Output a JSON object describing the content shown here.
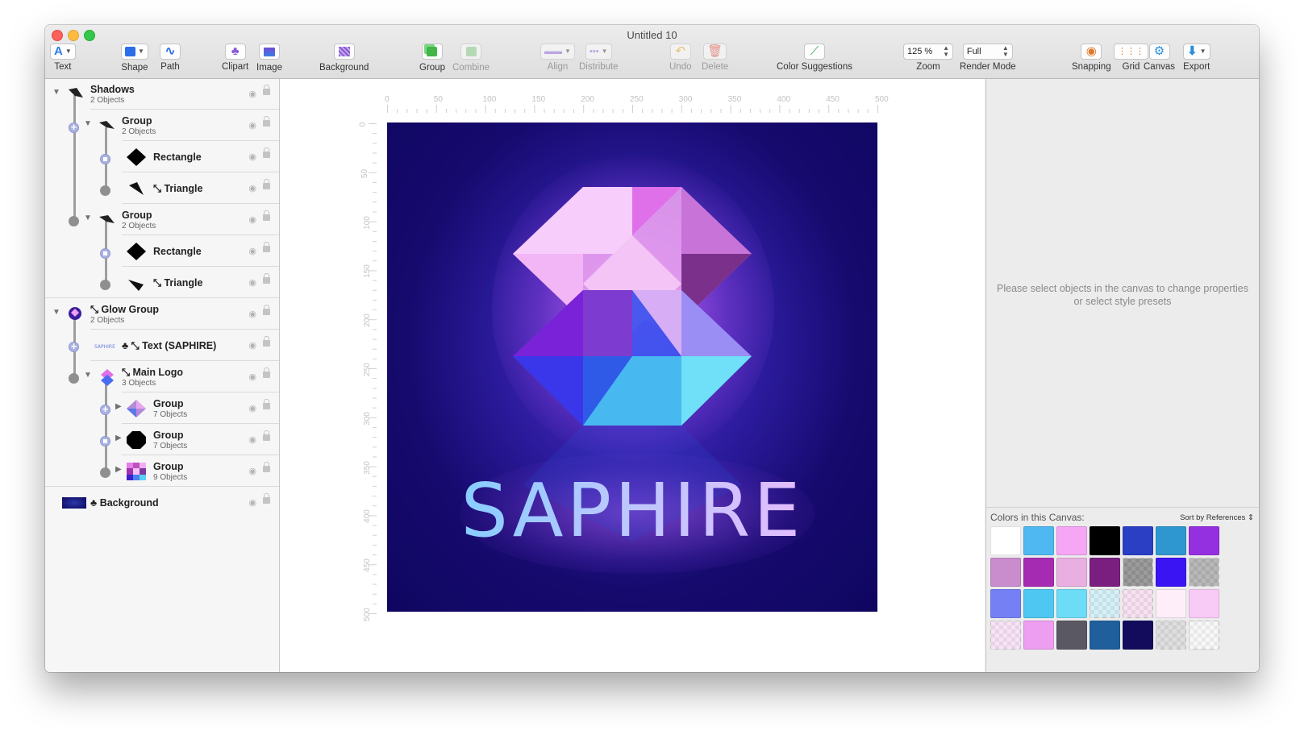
{
  "window": {
    "title": "Untitled 10"
  },
  "toolbar": {
    "text": "Text",
    "shape": "Shape",
    "path": "Path",
    "clipart": "Clipart",
    "image": "Image",
    "background": "Background",
    "group": "Group",
    "combine": "Combine",
    "align": "Align",
    "distribute": "Distribute",
    "undo": "Undo",
    "delete": "Delete",
    "color_suggestions": "Color Suggestions",
    "zoom_value": "125 %",
    "zoom": "Zoom",
    "render_mode_value": "Full",
    "render_mode": "Render Mode",
    "snapping": "Snapping",
    "grid": "Grid",
    "canvas": "Canvas",
    "export": "Export"
  },
  "layers": [
    {
      "name": "Shadows",
      "sub": "2 Objects"
    },
    {
      "name": "Group",
      "sub": "2 Objects"
    },
    {
      "name": "Rectangle",
      "sub": ""
    },
    {
      "name": "Triangle",
      "sub": ""
    },
    {
      "name": "Group",
      "sub": "2 Objects"
    },
    {
      "name": "Rectangle",
      "sub": ""
    },
    {
      "name": "Triangle",
      "sub": ""
    },
    {
      "name": "Glow Group",
      "sub": "2 Objects"
    },
    {
      "name": "Text (SAPHIRE)",
      "sub": ""
    },
    {
      "name": "Main Logo",
      "sub": "3 Objects"
    },
    {
      "name": "Group",
      "sub": "7 Objects"
    },
    {
      "name": "Group",
      "sub": "7 Objects"
    },
    {
      "name": "Group",
      "sub": "9 Objects"
    },
    {
      "name": "Background",
      "sub": ""
    }
  ],
  "canvas": {
    "artwork_text": "SAPHIRE",
    "ruler_h": [
      "0",
      "50",
      "100",
      "150",
      "200",
      "250",
      "300",
      "350",
      "400",
      "450",
      "500"
    ],
    "ruler_v": [
      "0",
      "50",
      "100",
      "150",
      "200",
      "250",
      "300",
      "350",
      "400",
      "450",
      "500"
    ]
  },
  "inspector": {
    "hint": "Please select objects in the canvas to change properties or select style presets",
    "colors_title": "Colors in this Canvas:",
    "sort_label": "Sort by References"
  },
  "swatches": [
    "#ffffff",
    "#4fb8f0",
    "#f5a6f5",
    "#000000",
    "#2a3fc4",
    "#2e97cf",
    "#9530e0",
    "#c98ccd",
    "#a52bb3",
    "#e9afe0",
    "#7a1f7f",
    "#5a5a5a",
    "#3a14f2",
    "#8a8a8a",
    "#7580f5",
    "#4ec8f2",
    "#6ddcf6",
    "#b9e6f2",
    "#f3cde6",
    "#fdeefa",
    "#f8caf6",
    "#f1d1ee",
    "#ee9ef0",
    "#5a5862",
    "#1e5f9c",
    "#130c5c",
    "#c9c9c9",
    "#f4f4f4"
  ]
}
